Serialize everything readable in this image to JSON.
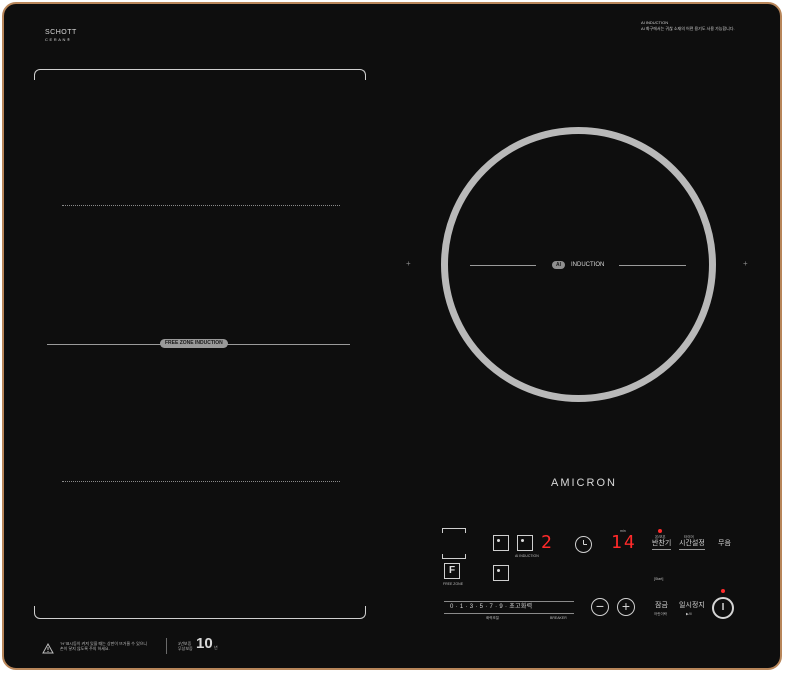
{
  "brand": {
    "name": "SCHOTT",
    "sub": "CERAN®"
  },
  "ai_note": {
    "title": "AI INDUCTION",
    "body": "AI 화구에서는 귀찮 소재의 어떤 용기도 사용 가능합니다."
  },
  "free_zone": {
    "label": "FREE ZONE INDUCTION"
  },
  "ai_zone": {
    "badge": "AI",
    "label": "INDUCTION"
  },
  "logo": "AMICRON",
  "controls": {
    "ai_induction_caption": "AI INDUCTION",
    "ai_display": "2",
    "timer_display": "14",
    "timer_unit": "min",
    "keep_warm_top": "온/보온",
    "keep_warm_label": "반찬기",
    "timer_top": "타이머",
    "timer_label": "시간설정",
    "mute_label": "무음",
    "start_tiny": "[Start]",
    "free_zone_caption": "FREE ZONE",
    "f_label": "F",
    "power_scale": "0 · 1 · 3 · 5 · 7 · 9 · 초고화력",
    "power_sub_left": "화력조절",
    "power_sub_right": "BREAKER",
    "minus_label": "−",
    "plus_label": "+",
    "lock_label": "잠금",
    "lock_sub": "어린이락",
    "pause_label": "일시정지",
    "pause_sub": "▶/II",
    "power_symbol": "I"
  },
  "footer": {
    "warning_line1": "\"H\"표시등이 켜져 있을 때는 상판이 뜨거울 수 있으니",
    "warning_line2": "손이 닿지 않도록 주의 하세요.",
    "warranty_top": "3년보증",
    "warranty_sub": "무상보증",
    "warranty_num": "10",
    "warranty_unit": "년"
  },
  "colors": {
    "panel": "#0e0e0e",
    "frame": "#b8865a",
    "display": "#ff2a2a"
  }
}
